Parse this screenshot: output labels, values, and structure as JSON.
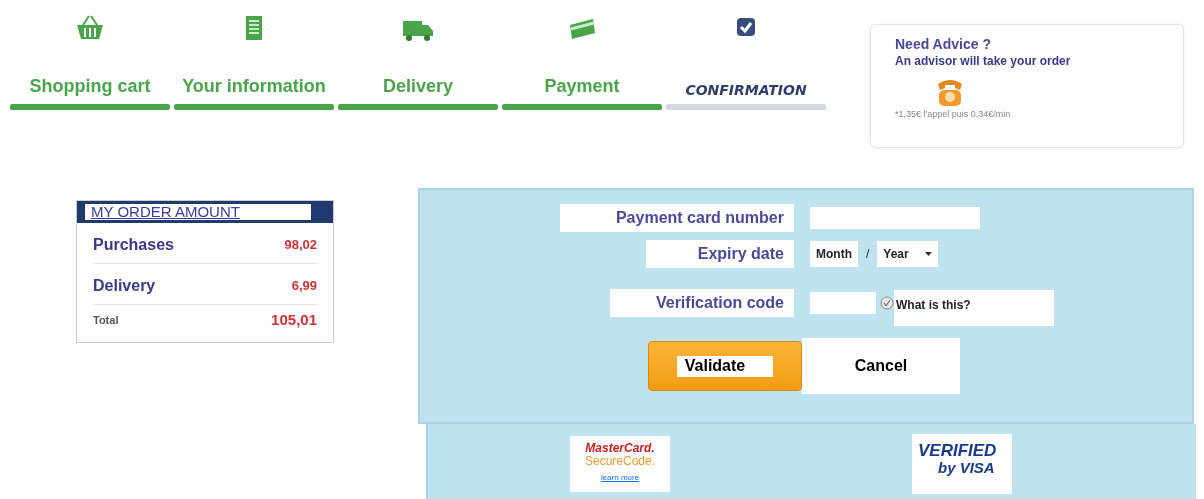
{
  "steps": [
    {
      "label": "Shopping cart",
      "done": true
    },
    {
      "label": "Your information",
      "done": true
    },
    {
      "label": "Delivery",
      "done": true
    },
    {
      "label": "Payment",
      "done": true
    },
    {
      "label": "CONFIRMATION",
      "done": false
    }
  ],
  "advice": {
    "title": "Need Advice ?",
    "subtitle": "An advisor will take your order",
    "note": "*1,35€ l'appel puis 0,34€/min"
  },
  "order": {
    "title": "MY ORDER AMOUNT",
    "lines": [
      {
        "label": "Purchases",
        "amount": "98,02",
        "kind": "line"
      },
      {
        "label": "Delivery",
        "amount": "6,99",
        "kind": "line"
      },
      {
        "label": "Total",
        "amount": "105,01",
        "kind": "total"
      }
    ]
  },
  "payment": {
    "card_label": "Payment card number",
    "expiry_label": "Expiry date",
    "month": "Month",
    "separator": "/",
    "year": "Year",
    "code_label": "Verification code",
    "help_link": "What is this?",
    "validate": "Validate",
    "cancel": "Cancel"
  },
  "logos": {
    "mastercard_line1": "MasterCard.",
    "mastercard_line2": "SecureCode.",
    "learn_more": "learn more",
    "visa_line1": "VERIFIED",
    "visa_line2": "by VISA"
  }
}
